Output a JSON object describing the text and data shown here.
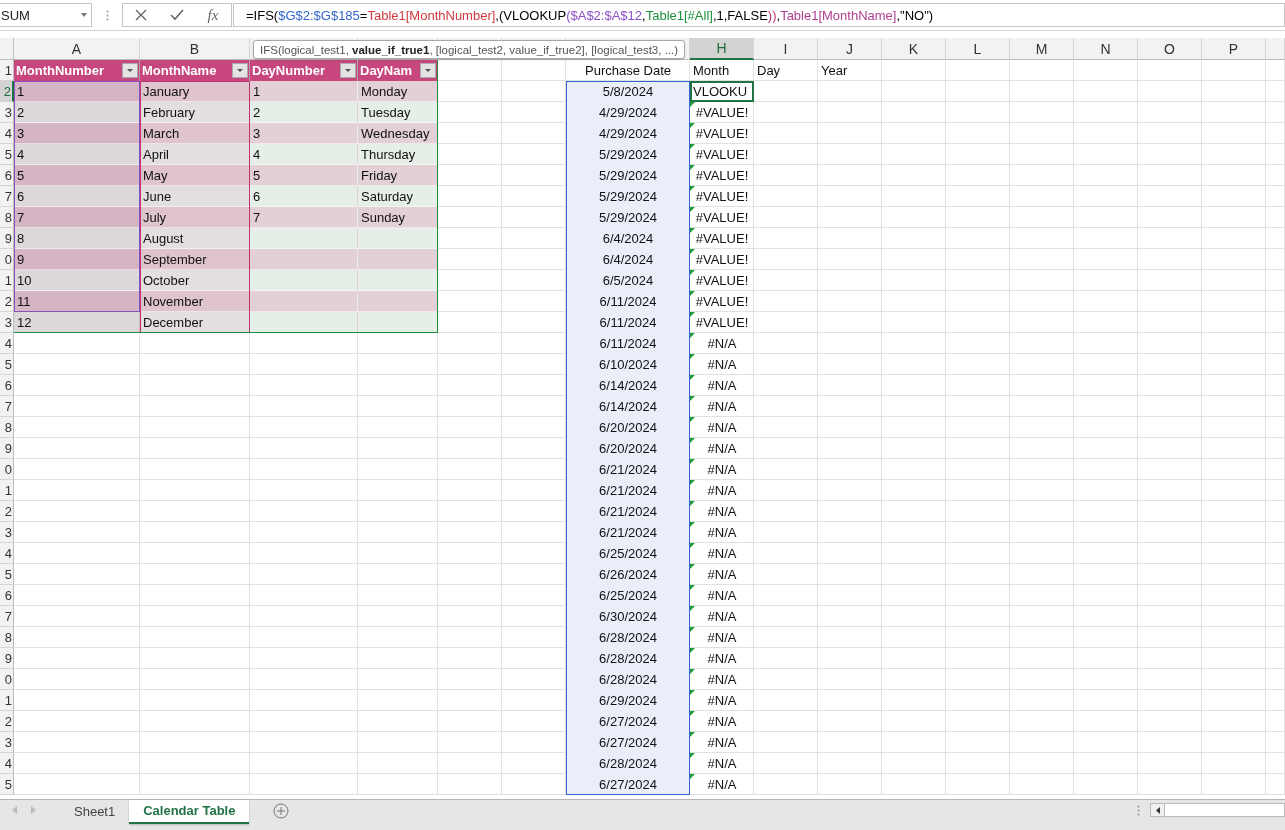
{
  "formula_bar": {
    "name_box": "SUM",
    "function_button": "fx",
    "formula": [
      {
        "text": "=IFS("
      },
      {
        "text": "$G$2:$G$185",
        "color": "#3366cc"
      },
      {
        "text": "="
      },
      {
        "text": "Table1[MonthNumber]",
        "color": "#d0393e"
      },
      {
        "text": ",("
      },
      {
        "text": "VLOOKUP"
      },
      {
        "text": "($A$2:$A$12",
        "color": "#8a4fc2"
      },
      {
        "text": ","
      },
      {
        "text": "Table1[#All]",
        "color": "#1d8f3c"
      },
      {
        "text": ",1,FALSE"
      },
      {
        "text": "))",
        "color": "#c0346e"
      },
      {
        "text": ","
      },
      {
        "text": "Table1[MonthName]",
        "color": "#b0408f"
      },
      {
        "text": ",\"NO\")"
      }
    ]
  },
  "tooltip": "IFS(logical_test1, **value_if_true1**, [logical_test2, value_if_true2], [logical_test3, ...)",
  "column_headers": {
    "before_tooltip": [
      {
        "label": "A",
        "selected": false
      },
      {
        "label": "B",
        "selected": false
      }
    ],
    "after_tooltip": [
      {
        "label": "H",
        "selected": true
      },
      {
        "label": "I",
        "selected": false
      },
      {
        "label": "J",
        "selected": false
      },
      {
        "label": "K",
        "selected": false
      },
      {
        "label": "L",
        "selected": false
      },
      {
        "label": "M",
        "selected": false
      },
      {
        "label": "N",
        "selected": false
      },
      {
        "label": "O",
        "selected": false
      },
      {
        "label": "P",
        "selected": false
      }
    ]
  },
  "row_headers": [
    {
      "label": "1",
      "selected": false
    },
    {
      "label": "2",
      "selected": true
    },
    {
      "label": "3",
      "selected": false
    },
    {
      "label": "4",
      "selected": false
    },
    {
      "label": "5",
      "selected": false
    },
    {
      "label": "6",
      "selected": false
    },
    {
      "label": "7",
      "selected": false
    },
    {
      "label": "8",
      "selected": false
    },
    {
      "label": "9",
      "selected": false
    },
    {
      "label": "0",
      "selected": false
    },
    {
      "label": "1",
      "selected": false
    },
    {
      "label": "2",
      "selected": false
    },
    {
      "label": "3",
      "selected": false
    },
    {
      "label": "4",
      "selected": false
    },
    {
      "label": "5",
      "selected": false
    },
    {
      "label": "6",
      "selected": false
    },
    {
      "label": "7",
      "selected": false
    },
    {
      "label": "8",
      "selected": false
    },
    {
      "label": "9",
      "selected": false
    },
    {
      "label": "0",
      "selected": false
    },
    {
      "label": "1",
      "selected": false
    },
    {
      "label": "2",
      "selected": false
    },
    {
      "label": "3",
      "selected": false
    },
    {
      "label": "4",
      "selected": false
    },
    {
      "label": "5",
      "selected": false
    },
    {
      "label": "6",
      "selected": false
    },
    {
      "label": "7",
      "selected": false
    },
    {
      "label": "8",
      "selected": false
    },
    {
      "label": "9",
      "selected": false
    },
    {
      "label": "0",
      "selected": false
    },
    {
      "label": "1",
      "selected": false
    },
    {
      "label": "2",
      "selected": false
    },
    {
      "label": "3",
      "selected": false
    },
    {
      "label": "4",
      "selected": false
    },
    {
      "label": "5",
      "selected": false
    }
  ],
  "calendar_table": {
    "columns": [
      "MonthNumber",
      "MonthName",
      "DayNumber",
      "DayNam"
    ],
    "rows": [
      {
        "cells": [
          "1",
          "January",
          "1",
          "Monday"
        ]
      },
      {
        "cells": [
          "2",
          "February",
          "2",
          "Tuesday"
        ]
      },
      {
        "cells": [
          "3",
          "March",
          "3",
          "Wednesday"
        ]
      },
      {
        "cells": [
          "4",
          "April",
          "4",
          "Thursday"
        ]
      },
      {
        "cells": [
          "5",
          "May",
          "5",
          "Friday"
        ]
      },
      {
        "cells": [
          "6",
          "June",
          "6",
          "Saturday"
        ]
      },
      {
        "cells": [
          "7",
          "July",
          "7",
          "Sunday"
        ]
      },
      {
        "cells": [
          "8",
          "August"
        ]
      },
      {
        "cells": [
          "9",
          "September"
        ]
      },
      {
        "cells": [
          "10",
          "October"
        ]
      },
      {
        "cells": [
          "11",
          "November"
        ]
      },
      {
        "cells": [
          "12",
          "December"
        ]
      }
    ]
  },
  "purchases": {
    "columns": [
      "Purchase Date",
      "Month",
      "Day",
      "Year"
    ],
    "rows": [
      {
        "date": "5/8/2024",
        "month": "VLOOKU",
        "kind": "editing",
        "flagged": false
      },
      {
        "date": "4/29/2024",
        "month": "#VALUE!",
        "kind": "result",
        "flagged": true
      },
      {
        "date": "4/29/2024",
        "month": "#VALUE!",
        "kind": "result",
        "flagged": true
      },
      {
        "date": "5/29/2024",
        "month": "#VALUE!",
        "kind": "result",
        "flagged": true
      },
      {
        "date": "5/29/2024",
        "month": "#VALUE!",
        "kind": "result",
        "flagged": true
      },
      {
        "date": "5/29/2024",
        "month": "#VALUE!",
        "kind": "result",
        "flagged": true
      },
      {
        "date": "5/29/2024",
        "month": "#VALUE!",
        "kind": "result",
        "flagged": true
      },
      {
        "date": "6/4/2024",
        "month": "#VALUE!",
        "kind": "result",
        "flagged": true
      },
      {
        "date": "6/4/2024",
        "month": "#VALUE!",
        "kind": "result",
        "flagged": true
      },
      {
        "date": "6/5/2024",
        "month": "#VALUE!",
        "kind": "result",
        "flagged": true
      },
      {
        "date": "6/11/2024",
        "month": "#VALUE!",
        "kind": "result",
        "flagged": true
      },
      {
        "date": "6/11/2024",
        "month": "#VALUE!",
        "kind": "result",
        "flagged": true
      },
      {
        "date": "6/11/2024",
        "month": "#N/A",
        "kind": "result",
        "flagged": true
      },
      {
        "date": "6/10/2024",
        "month": "#N/A",
        "kind": "result",
        "flagged": true
      },
      {
        "date": "6/14/2024",
        "month": "#N/A",
        "kind": "result",
        "flagged": true
      },
      {
        "date": "6/14/2024",
        "month": "#N/A",
        "kind": "result",
        "flagged": true
      },
      {
        "date": "6/20/2024",
        "month": "#N/A",
        "kind": "result",
        "flagged": true
      },
      {
        "date": "6/20/2024",
        "month": "#N/A",
        "kind": "result",
        "flagged": true
      },
      {
        "date": "6/21/2024",
        "month": "#N/A",
        "kind": "result",
        "flagged": true
      },
      {
        "date": "6/21/2024",
        "month": "#N/A",
        "kind": "result",
        "flagged": true
      },
      {
        "date": "6/21/2024",
        "month": "#N/A",
        "kind": "result",
        "flagged": true
      },
      {
        "date": "6/21/2024",
        "month": "#N/A",
        "kind": "result",
        "flagged": true
      },
      {
        "date": "6/25/2024",
        "month": "#N/A",
        "kind": "result",
        "flagged": true
      },
      {
        "date": "6/26/2024",
        "month": "#N/A",
        "kind": "result",
        "flagged": true
      },
      {
        "date": "6/25/2024",
        "month": "#N/A",
        "kind": "result",
        "flagged": true
      },
      {
        "date": "6/30/2024",
        "month": "#N/A",
        "kind": "result",
        "flagged": true
      },
      {
        "date": "6/28/2024",
        "month": "#N/A",
        "kind": "result",
        "flagged": true
      },
      {
        "date": "6/28/2024",
        "month": "#N/A",
        "kind": "result",
        "flagged": true
      },
      {
        "date": "6/28/2024",
        "month": "#N/A",
        "kind": "result",
        "flagged": true
      },
      {
        "date": "6/29/2024",
        "month": "#N/A",
        "kind": "result",
        "flagged": true
      },
      {
        "date": "6/27/2024",
        "month": "#N/A",
        "kind": "result",
        "flagged": true
      },
      {
        "date": "6/27/2024",
        "month": "#N/A",
        "kind": "result",
        "flagged": true
      },
      {
        "date": "6/28/2024",
        "month": "#N/A",
        "kind": "result",
        "flagged": true
      },
      {
        "date": "6/27/2024",
        "month": "#N/A",
        "kind": "result",
        "flagged": true
      }
    ]
  },
  "sheet_tabs": [
    {
      "label": "Sheet1",
      "selected": false
    },
    {
      "label": "Calendar Table",
      "selected": true
    }
  ]
}
